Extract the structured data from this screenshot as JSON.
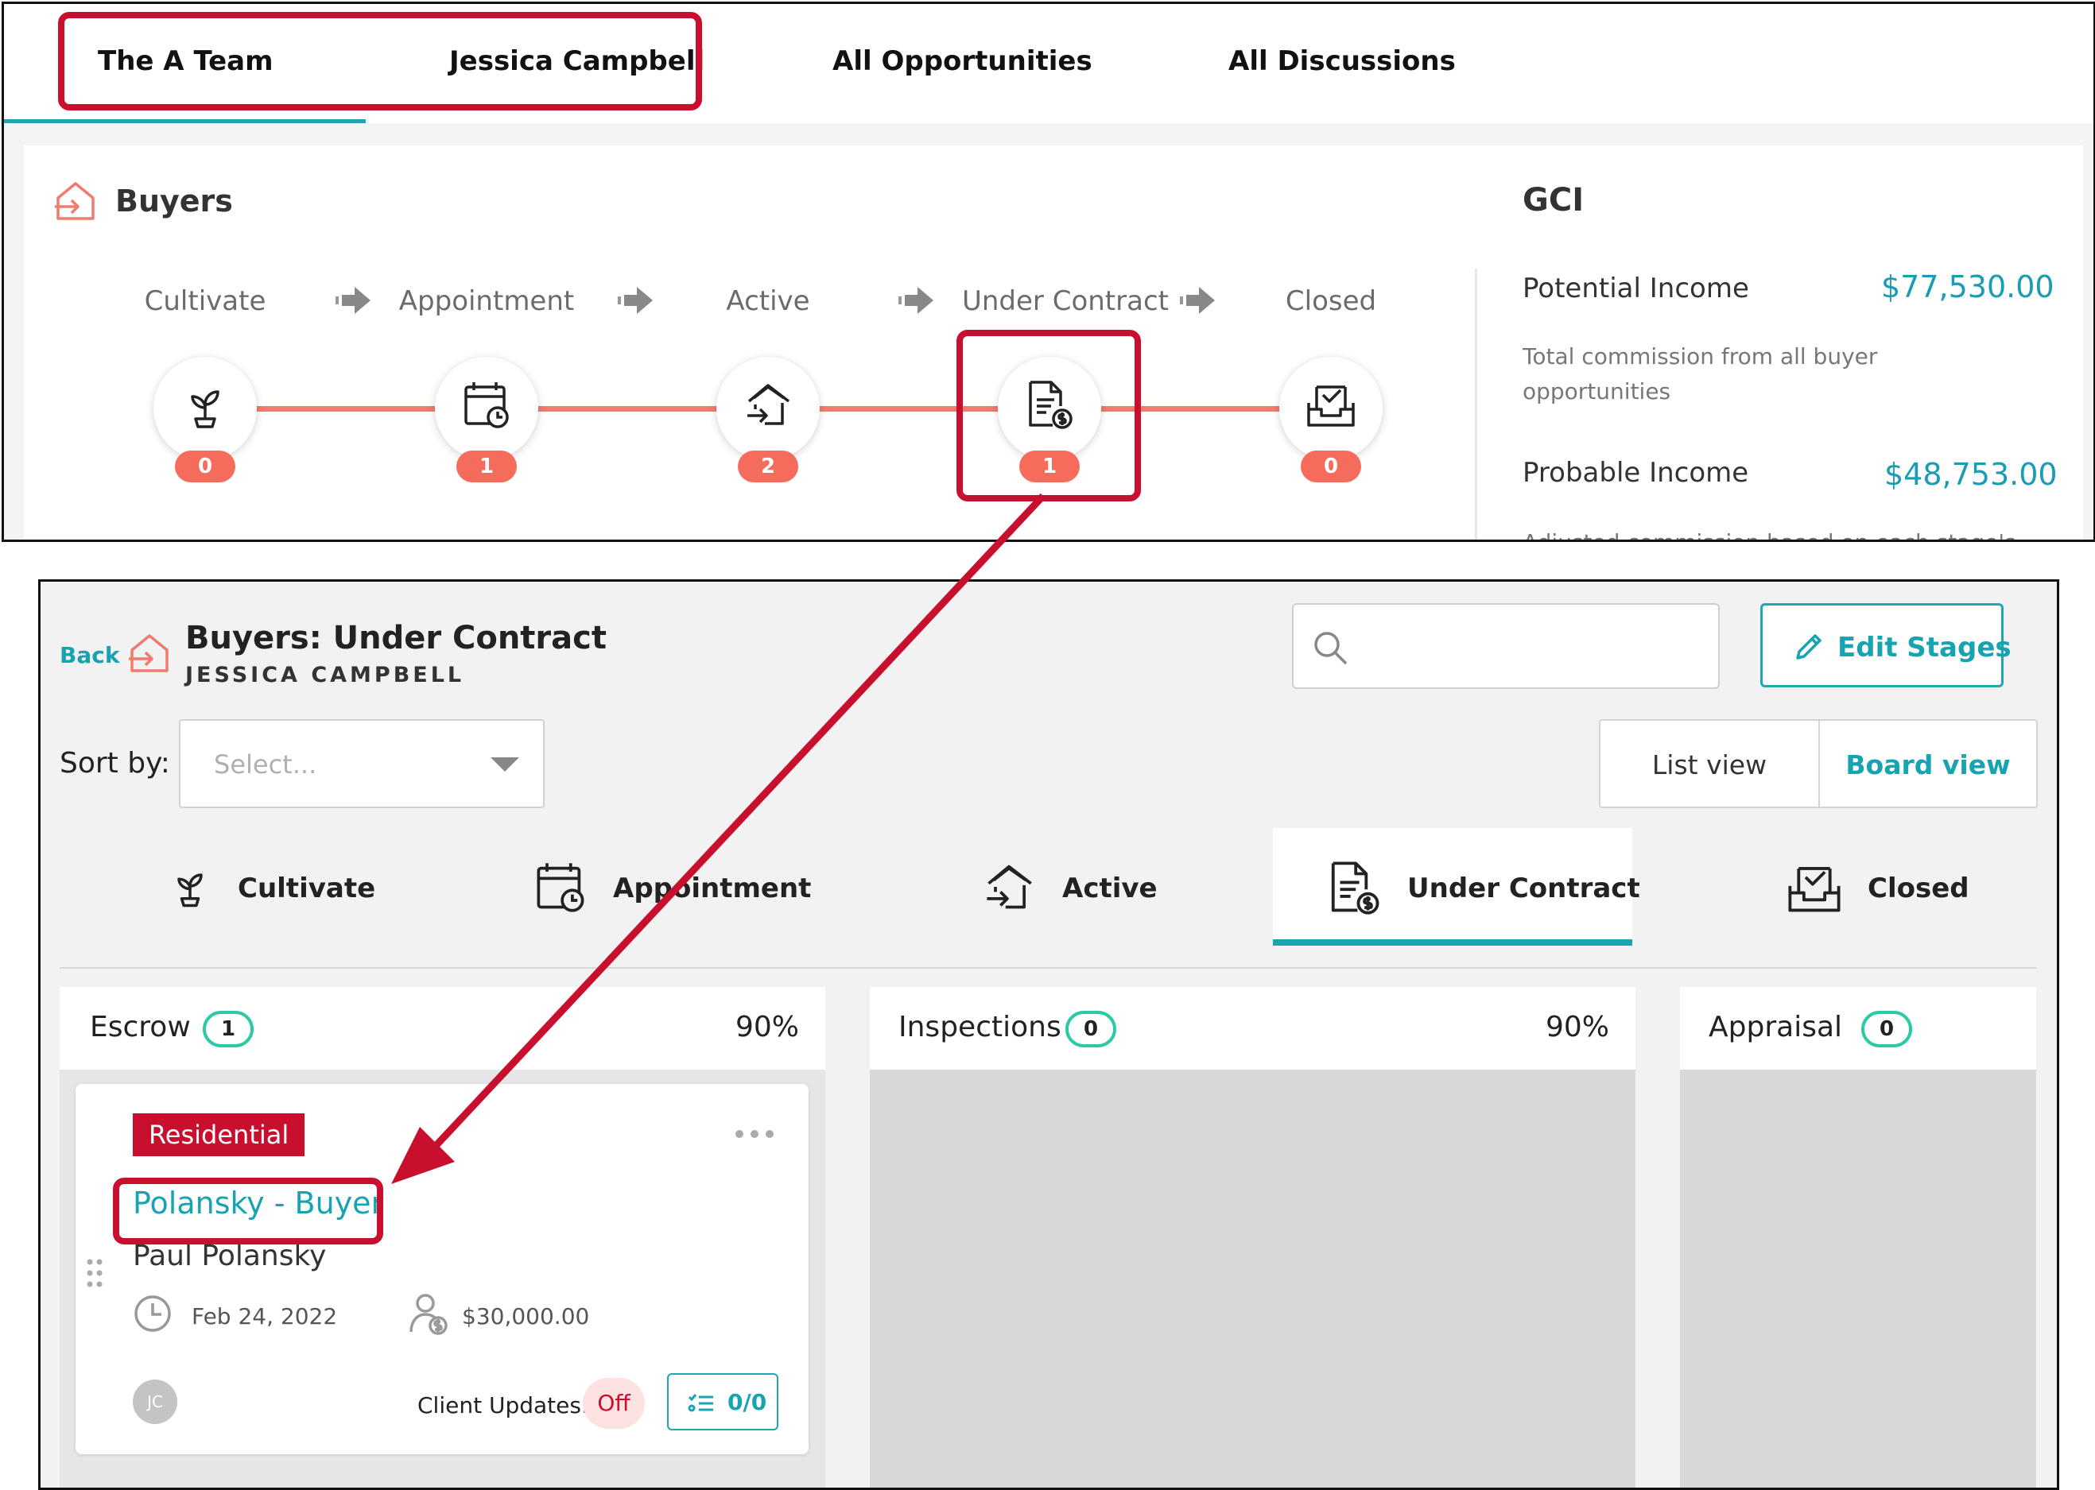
{
  "top_tabs": {
    "team": "The A Team",
    "agent": "Jessica Campbell",
    "opportunities": "All Opportunities",
    "discussions": "All Discussions"
  },
  "buyers_panel": {
    "title": "Buyers",
    "stages": [
      {
        "label": "Cultivate",
        "count": "0",
        "icon": "plant-icon"
      },
      {
        "label": "Appointment",
        "count": "1",
        "icon": "calendar-clock-icon"
      },
      {
        "label": "Active",
        "count": "2",
        "icon": "house-arrow-icon"
      },
      {
        "label": "Under Contract",
        "count": "1",
        "icon": "contract-dollar-icon"
      },
      {
        "label": "Closed",
        "count": "0",
        "icon": "inbox-check-icon"
      }
    ]
  },
  "gci": {
    "title": "GCI",
    "potential_label": "Potential Income",
    "potential_value": "$77,530.00",
    "potential_desc": "Total commission from all buyer opportunities",
    "probable_label": "Probable Income",
    "probable_value": "$48,753.00",
    "probable_desc": "Adjusted commission based on each stage's"
  },
  "detail": {
    "back": "Back",
    "title": "Buyers: Under Contract",
    "subtitle": "JESSICA CAMPBELL",
    "search_placeholder": "",
    "edit_stages": "Edit Stages",
    "sort_label": "Sort by:",
    "sort_placeholder": "Select...",
    "list_view": "List view",
    "board_view": "Board view",
    "stage_tabs": [
      "Cultivate",
      "Appointment",
      "Active",
      "Under Contract",
      "Closed"
    ],
    "active_stage": "Under Contract"
  },
  "columns": [
    {
      "name": "Escrow",
      "count": "1",
      "percent": "90%"
    },
    {
      "name": "Inspections",
      "count": "0",
      "percent": "90%"
    },
    {
      "name": "Appraisal",
      "count": "0",
      "percent": ""
    }
  ],
  "card": {
    "tag": "Residential",
    "title": "Polansky - Buyer",
    "client": "Paul Polansky",
    "date": "Feb 24, 2022",
    "amount": "$30,000.00",
    "avatar": "JC",
    "client_updates_label": "Client Updates:",
    "client_updates_value": "Off",
    "tasks": "0/0"
  },
  "colors": {
    "accent": "#18a3b1",
    "badge": "#f56b5c",
    "annotation": "#c8102e",
    "pill_border": "#2cc9a6"
  }
}
